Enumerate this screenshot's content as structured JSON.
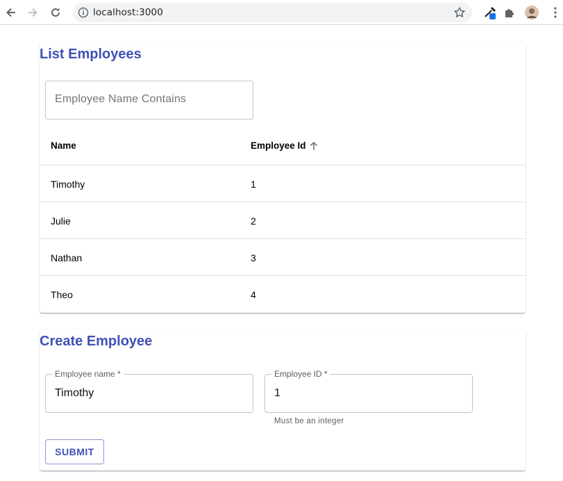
{
  "browser": {
    "url": "localhost:3000"
  },
  "list": {
    "title": "List Employees",
    "search_placeholder": "Employee Name Contains",
    "search_value": "",
    "columns": [
      "Name",
      "Employee Id"
    ],
    "sort_column": "Employee Id",
    "sort_direction": "ascending",
    "rows": [
      {
        "name": "Timothy",
        "id": "1"
      },
      {
        "name": "Julie",
        "id": "2"
      },
      {
        "name": "Nathan",
        "id": "3"
      },
      {
        "name": "Theo",
        "id": "4"
      }
    ]
  },
  "create": {
    "title": "Create Employee",
    "name_label": "Employee name *",
    "name_value": "Timothy",
    "id_label": "Employee ID *",
    "id_value": "1",
    "id_helper": "Must be an integer",
    "submit_label": "SUBMIT"
  },
  "colors": {
    "accent": "#3f51b5",
    "border": "#c4c4c4",
    "divider": "#e0e0e0"
  }
}
